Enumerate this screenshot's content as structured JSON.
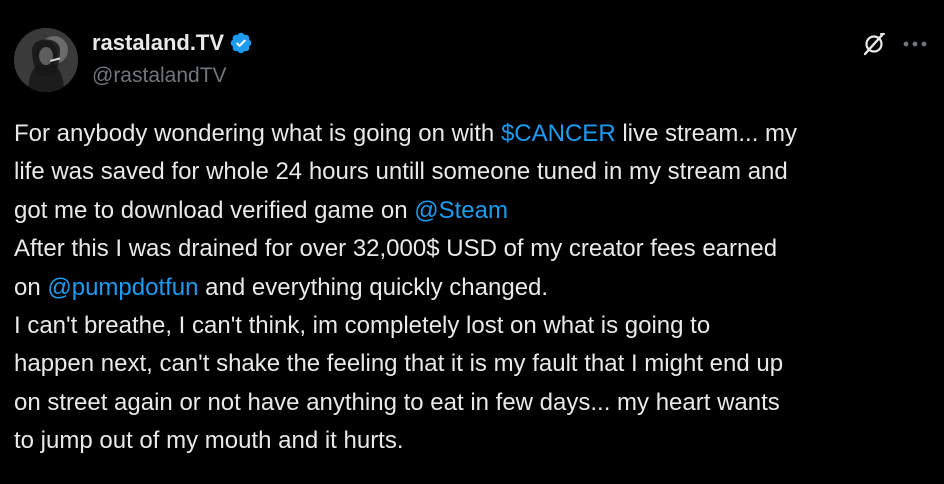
{
  "author": {
    "display_name": "rastaland.TV",
    "handle": "@rastalandTV",
    "verified": true,
    "verified_color": "#1d9bf0"
  },
  "actions": {
    "grok_icon": "grok-icon",
    "more_icon": "more-icon"
  },
  "colors": {
    "background": "#000000",
    "text": "#e7e9ea",
    "secondary_text": "#71767b",
    "link": "#1d9bf0"
  },
  "tweet": {
    "lines": [
      {
        "segments": [
          {
            "text": "For anybody wondering what is going on with ",
            "link": false
          },
          {
            "text": "$CANCER",
            "link": true
          },
          {
            "text": " live stream... my",
            "link": false
          }
        ]
      },
      {
        "segments": [
          {
            "text": "life was saved for whole 24 hours untill someone tuned in my stream and",
            "link": false
          }
        ]
      },
      {
        "segments": [
          {
            "text": "got me to download verified game on ",
            "link": false
          },
          {
            "text": "@Steam",
            "link": true
          }
        ]
      },
      {
        "segments": [
          {
            "text": "After this I was drained for over 32,000$ USD of my creator fees earned",
            "link": false
          }
        ]
      },
      {
        "segments": [
          {
            "text": "on ",
            "link": false
          },
          {
            "text": "@pumpdotfun",
            "link": true
          },
          {
            "text": " and everything quickly changed.",
            "link": false
          }
        ]
      },
      {
        "segments": [
          {
            "text": "I can't breathe, I can't think, im completely lost on what is going to",
            "link": false
          }
        ]
      },
      {
        "segments": [
          {
            "text": "happen next, can't shake the feeling that it is my fault that I might end up",
            "link": false
          }
        ]
      },
      {
        "segments": [
          {
            "text": "on street again or not have anything to eat in few days... my heart wants",
            "link": false
          }
        ]
      },
      {
        "segments": [
          {
            "text": "to jump out of my mouth and it hurts.",
            "link": false
          }
        ]
      }
    ]
  }
}
